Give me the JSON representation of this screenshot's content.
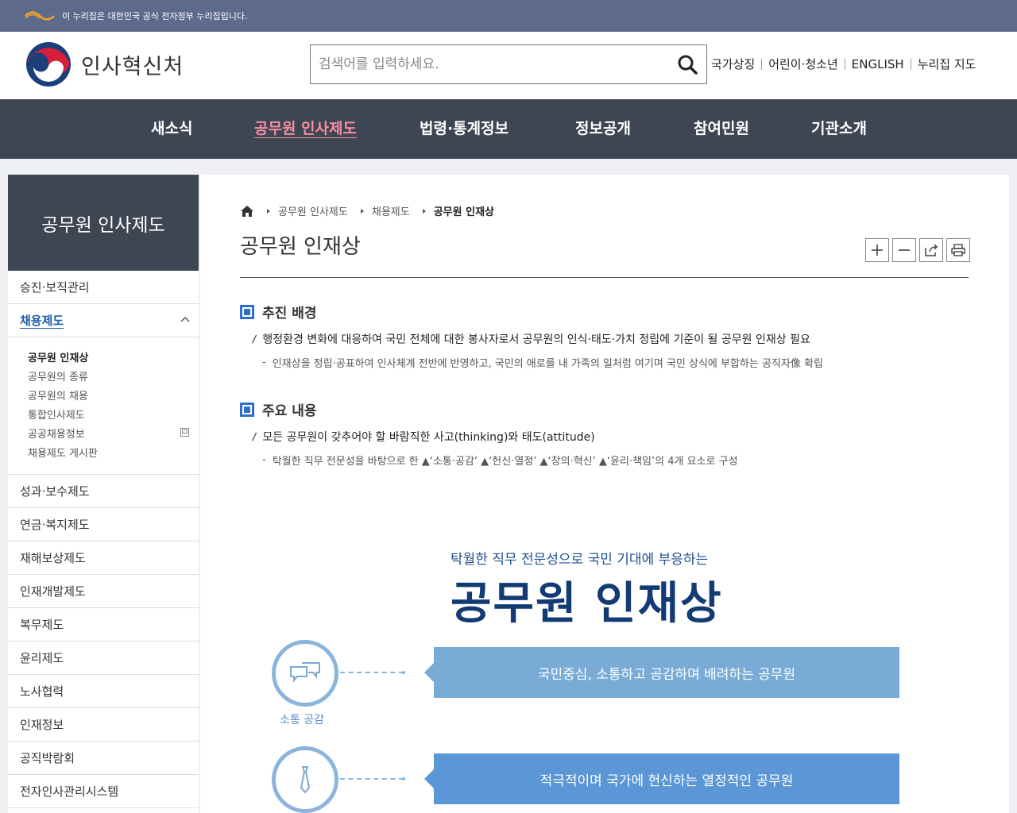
{
  "gov_banner": {
    "text": "이 누리집은 대한민국 공식 전자정부 누리집입니다."
  },
  "header": {
    "logo_text": "인사혁신처",
    "search": {
      "placeholder": "검색어를 입력하세요.",
      "value": ""
    },
    "util_links": [
      "국가상징",
      "어린이·청소년",
      "ENGLISH",
      "누리집 지도"
    ]
  },
  "gnb": {
    "items": [
      "새소식",
      "공무원 인사제도",
      "법령·통계정보",
      "정보공개",
      "참여민원",
      "기관소개"
    ],
    "active_index": 1
  },
  "sidebar": {
    "title": "공무원 인사제도",
    "items_before": [
      "승진·보직관리"
    ],
    "active": "채용제도",
    "sub_items": [
      "공무원 인재상",
      "공무원의 종류",
      "공무원의 채용",
      "통합인사제도",
      "공공채용정보",
      "채용제도 게시판"
    ],
    "sub_active_index": 0,
    "items_after": [
      "성과·보수제도",
      "연금·복지제도",
      "재해보상제도",
      "인재개발제도",
      "복무제도",
      "윤리제도",
      "노사협력",
      "인재정보",
      "공직박람회",
      "전자인사관리시스템"
    ]
  },
  "breadcrumb": {
    "items": [
      "공무원 인사제도",
      "채용제도"
    ],
    "current": "공무원 인재상"
  },
  "page": {
    "title": "공무원 인재상",
    "sections": [
      {
        "title": "추진 배경",
        "bullet": "행정환경 변화에 대응하여 국민 전체에 대한 봉사자로서 공무원의 인식·태도·가치 정립에 기준이 될 공무원 인재상 필요",
        "sub": "인재상을 정립·공표하여 인사체계 전반에 반영하고, 국민의 애로를 내 가족의 일처럼 여기며 국민 상식에 부합하는 공직자像 확립"
      },
      {
        "title": "주요 내용",
        "bullet": "모든 공무원이 갖추어야 할 바람직한 사고(thinking)와 태도(attitude)",
        "sub": "탁월한 직무 전문성을 바탕으로 한 ▲‘소통·공감’ ▲‘헌신·열정’ ▲‘창의·혁신’ ▲‘윤리·책임’의 4개 요소로 구성"
      }
    ],
    "hero": {
      "subtitle": "탁월한 직무 전문성으로 국민 기대에 부응하는",
      "title": "공무원 인재상"
    },
    "values": [
      {
        "label": "소통 공감",
        "icon": "speech-bubbles-icon",
        "text": "국민중심, 소통하고 공감하며 배려하는 공무원",
        "color": "#78acd6"
      },
      {
        "label": "",
        "icon": "necktie-icon",
        "text": "적극적이며 국가에 헌신하는 열정적인 공무원",
        "color": "#5b96d6"
      }
    ]
  },
  "colors": {
    "banner": "#5e6a8c",
    "nav": "#3e4553",
    "nav_active": "#f38fa0",
    "accent": "#2f6fd0",
    "hero_title": "#123a73"
  }
}
